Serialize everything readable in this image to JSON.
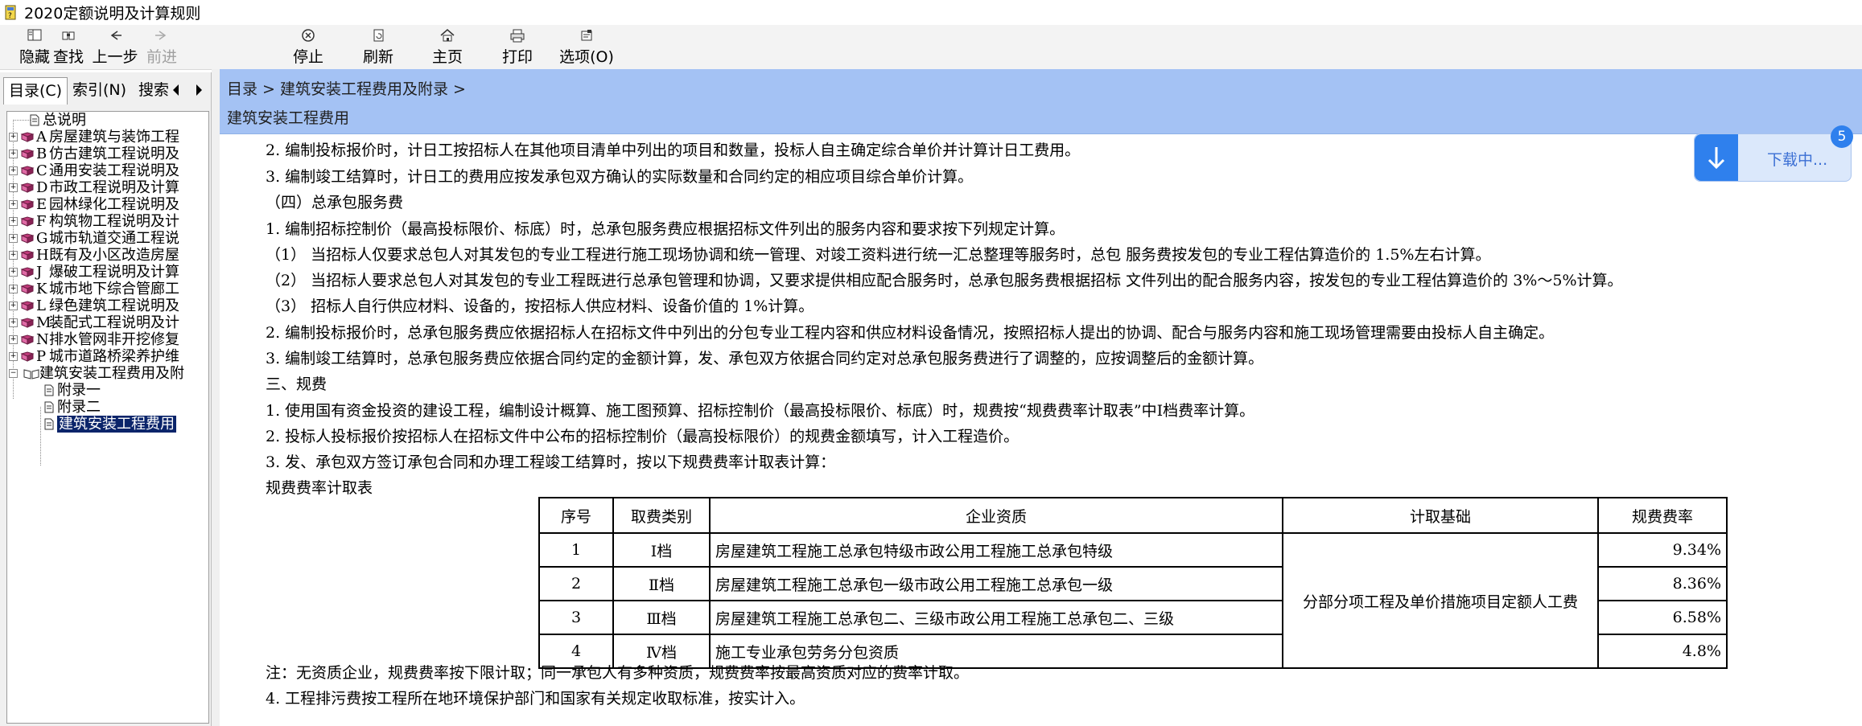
{
  "window": {
    "title": "2020定额说明及计算规则"
  },
  "toolbar": {
    "hide": "隐藏",
    "find": "查找",
    "back": "上一步",
    "forward": "前进",
    "stop": "停止",
    "refresh": "刷新",
    "home": "主页",
    "print": "打印",
    "options": "选项(O)"
  },
  "left_tabs": {
    "contents": "目录(C)",
    "index": "索引(N)",
    "search": "搜索"
  },
  "tree": {
    "root": "总说明",
    "items": [
      {
        "key": "A",
        "label": "房屋建筑与装饰工程"
      },
      {
        "key": "B",
        "label": "仿古建筑工程说明及"
      },
      {
        "key": "C",
        "label": "通用安装工程说明及"
      },
      {
        "key": "D",
        "label": "市政工程说明及计算"
      },
      {
        "key": "E",
        "label": "园林绿化工程说明及"
      },
      {
        "key": "F",
        "label": "构筑物工程说明及计"
      },
      {
        "key": "G",
        "label": "城市轨道交通工程说"
      },
      {
        "key": "H",
        "label": "既有及小区改造房屋"
      },
      {
        "key": "J",
        "label": "爆破工程说明及计算"
      },
      {
        "key": "K",
        "label": "城市地下综合管廊工"
      },
      {
        "key": "L",
        "label": "绿色建筑工程说明及"
      },
      {
        "key": "M",
        "label": "装配式工程说明及计"
      },
      {
        "key": "N",
        "label": "排水管网非开挖修复"
      },
      {
        "key": "P",
        "label": "城市道路桥梁养护维"
      }
    ],
    "open_folder": "建筑安装工程费用及附",
    "children": [
      "附录一",
      "附录二",
      "建筑安装工程费用"
    ]
  },
  "nav": {
    "breadcrumb": "目录 > 建筑安装工程费用及附录 >",
    "page_title": "建筑安装工程费用"
  },
  "doc": {
    "lines": [
      "2.  编制投标报价时，计日工按招标人在其他项目清单中列出的项目和数量，投标人自主确定综合单价并计算计日工费用。",
      "3.  编制竣工结算时，计日工的费用应按发承包双方确认的实际数量和合同约定的相应项目综合单价计算。",
      "（四）总承包服务费",
      "1.  编制招标控制价（最高投标限价、标底）时，总承包服务费应根据招标文件列出的服务内容和要求按下列规定计算。",
      "（1）  当招标人仅要求总包人对其发包的专业工程进行施工现场协调和统一管理、对竣工资料进行统一汇总整理等服务时，总包 服务费按发包的专业工程估算造价的 1.5%左右计算。",
      "（2）  当招标人要求总包人对其发包的专业工程既进行总承包管理和协调，又要求提供相应配合服务时，总承包服务费根据招标 文件列出的配合服务内容，按发包的专业工程估算造价的 3%～5%计算。",
      "（3）  招标人自行供应材料、设备的，按招标人供应材料、设备价值的 1%计算。",
      "2.  编制投标报价时，总承包服务费应依据招标人在招标文件中列出的分包专业工程内容和供应材料设备情况，按照招标人提出的协调、配合与服务内容和施工现场管理需要由投标人自主确定。",
      "3.  编制竣工结算时，总承包服务费应依据合同约定的金额计算，发、承包双方依据合同约定对总承包服务费进行了调整的，应按调整后的金额计算。",
      "三、规费",
      "1.  使用国有资金投资的建设工程，编制设计概算、施工图预算、招标控制价（最高投标限价、标底）时，规费按“规费费率计取表”中Ⅰ档费率计算。",
      "2.  投标人投标报价按招标人在招标文件中公布的招标控制价（最高投标限价）的规费金额填写，计入工程造价。",
      "3.  发、承包双方签订承包合同和办理工程竣工结算时，按以下规费费率计取表计算：",
      "规费费率计取表"
    ],
    "table": {
      "headers": [
        "序号",
        "取费类别",
        "企业资质",
        "计取基础",
        "规费费率"
      ],
      "rows": [
        {
          "no": "1",
          "cat": "Ⅰ档",
          "qual": "房屋建筑工程施工总承包特级市政公用工程施工总承包特级",
          "rate": "9.34%"
        },
        {
          "no": "2",
          "cat": "Ⅱ档",
          "qual": "房屋建筑工程施工总承包一级市政公用工程施工总承包一级",
          "rate": "8.36%"
        },
        {
          "no": "3",
          "cat": "Ⅲ档",
          "qual": "房屋建筑工程施工总承包二、三级市政公用工程施工总承包二、三级",
          "rate": "6.58%"
        },
        {
          "no": "4",
          "cat": "Ⅳ档",
          "qual": "施工专业承包劳务分包资质",
          "rate": "4.8%"
        }
      ],
      "basis": "分部分项工程及单价措施项目定额人工费"
    },
    "note": "注：无资质企业，规费费率按下限计取；同一承包人有多种资质，规费费率按最高资质对应的费率计取。",
    "last_line": "4.  工程排污费按工程所在地环境保护部门和国家有关规定收取标准，按实计入。"
  },
  "download": {
    "label": "下载中...",
    "badge": "5"
  },
  "colors": {
    "nav_bar": "#a4c2f4",
    "selection": "#0a246a",
    "download_accent": "#2f80ed"
  }
}
